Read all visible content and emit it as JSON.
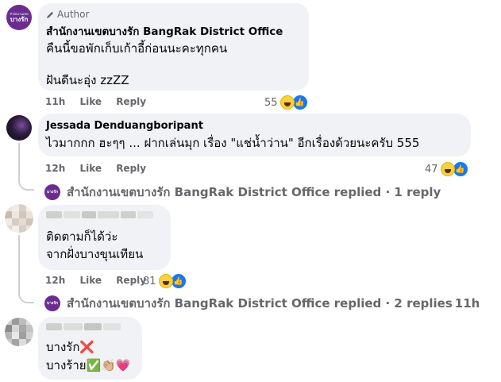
{
  "comments": [
    {
      "author_badge": "Author",
      "author": "สำนักงานเขตบางรัก BangRak District Office",
      "lines": [
        "คืนนี้ขอพักเก็บเก้าอี้ก่อนนะคะทุกคน",
        "ฝันดีนะอุ่ง zzZZ"
      ],
      "time": "11h",
      "like": "Like",
      "reply": "Reply",
      "reactions": "55",
      "avatar_small": "สำนักงานเขต",
      "avatar_big": "บางรัก"
    },
    {
      "author": "Jessada Denduangboripant",
      "lines": [
        "ไวมากกก ฮะๆๆ ... ฝากเล่นมุก เรื่อง \"แช่น้ำว่าน\" อีกเรื่องด้วยนะครับ 555"
      ],
      "time": "12h",
      "like": "Like",
      "reply": "Reply",
      "reactions": "47",
      "replied": "สำนักงานเขตบางรัก BangRak District Office replied · 1 reply"
    },
    {
      "lines": [
        "ติดตามก็ได้ว่ะ",
        "จากฝั่งบางขุนเทียน"
      ],
      "time": "12h",
      "like": "Like",
      "reply": "Reply",
      "reactions": "81",
      "replied": "สำนักงานเขตบางรัก BangRak District Office replied · 2 replies",
      "replied_time": "11h"
    },
    {
      "lines": [
        "บางรัก❌",
        "บางร้าย✅👏🏼💗"
      ]
    }
  ],
  "icons": {
    "pencil": "pencil-icon",
    "haha": "haha-reaction-icon",
    "like": "like-reaction-icon"
  },
  "colors": {
    "brand_purple": "#6b2c91",
    "bubble": "#f0f2f5",
    "meta": "#65676b",
    "like_blue": "#1877f2"
  }
}
